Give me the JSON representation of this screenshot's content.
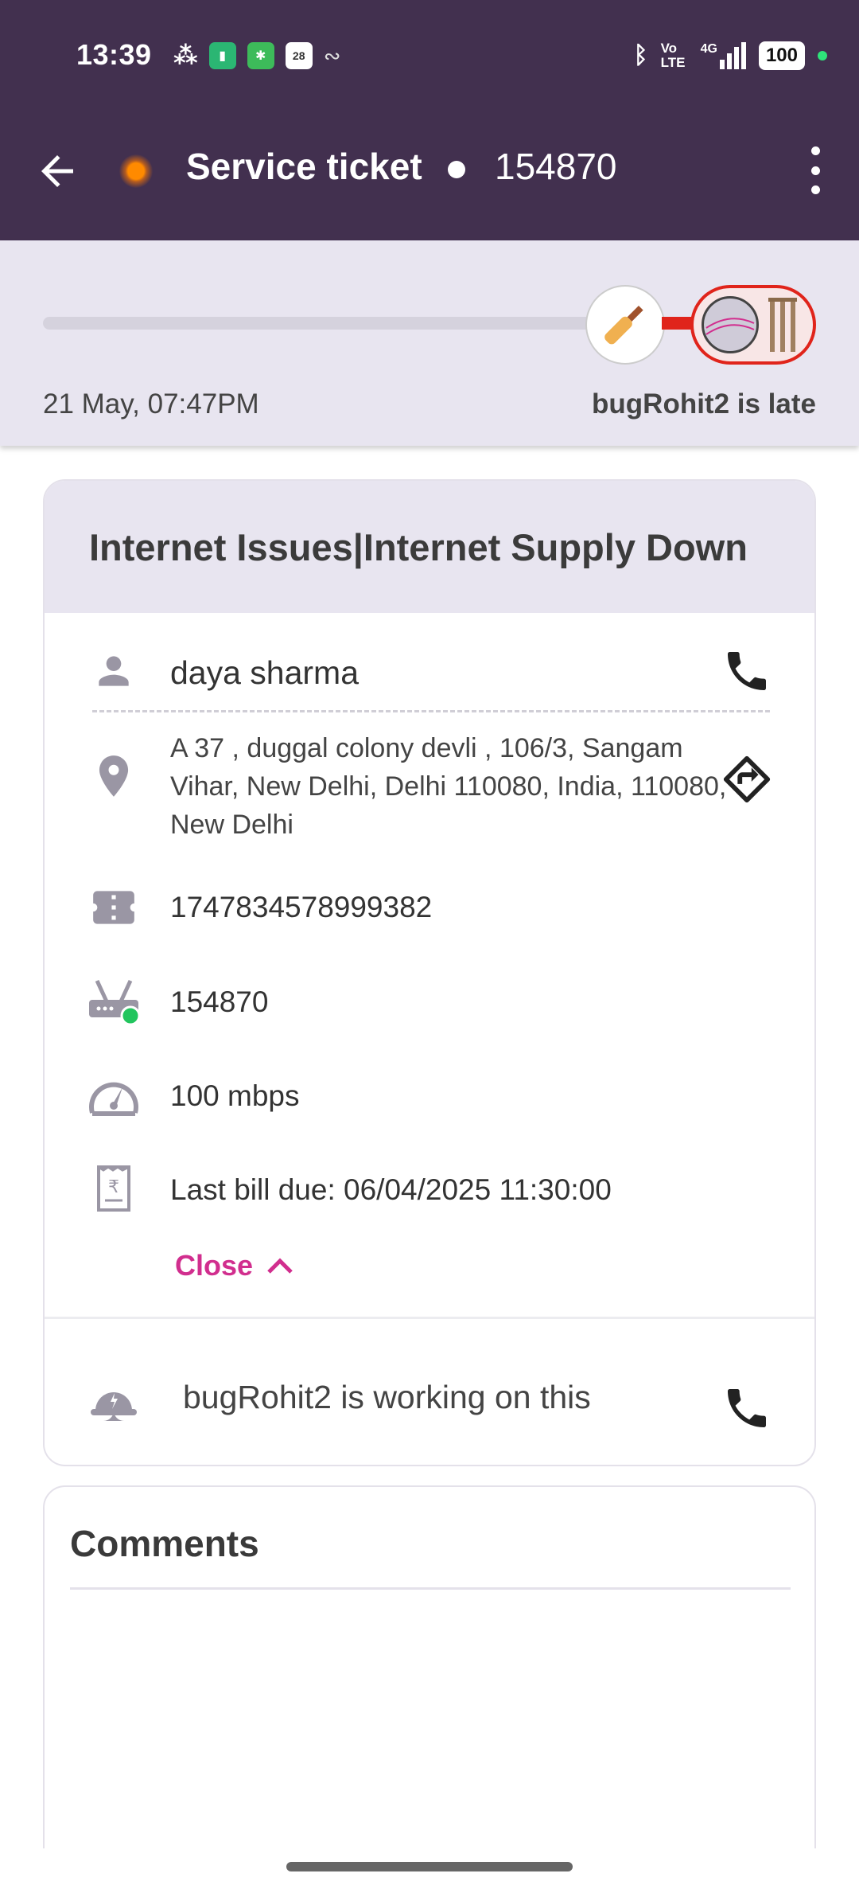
{
  "status_bar": {
    "time": "13:39",
    "calendar_day": "28",
    "network": "4G",
    "volte": "Vo LTE",
    "battery": "100"
  },
  "header": {
    "title": "Service ticket",
    "ticket_number": "154870"
  },
  "progress": {
    "date": "21 May, 07:47PM",
    "status": "bugRohit2 is late",
    "fill_fraction": 1.0
  },
  "ticket": {
    "title": "Internet Issues|Internet Supply Down",
    "customer_name": "daya sharma",
    "address": "A 37 , duggal colony devli , 106/3, Sangam Vihar, New Delhi, Delhi 110080, India, 110080, New Delhi",
    "account_id": "1747834578999382",
    "device_id": "154870",
    "speed": "100 mbps",
    "last_bill": "Last bill due: 06/04/2025 11:30:00",
    "close_label": "Close",
    "technician_status": "bugRohit2 is working on this"
  },
  "comments": {
    "title": "Comments"
  },
  "colors": {
    "header_bg": "#42304f",
    "progress_bg": "#e8e5f0",
    "accent_pink": "#d12e8e",
    "late_red": "#e0241b",
    "online_green": "#22c55e"
  }
}
